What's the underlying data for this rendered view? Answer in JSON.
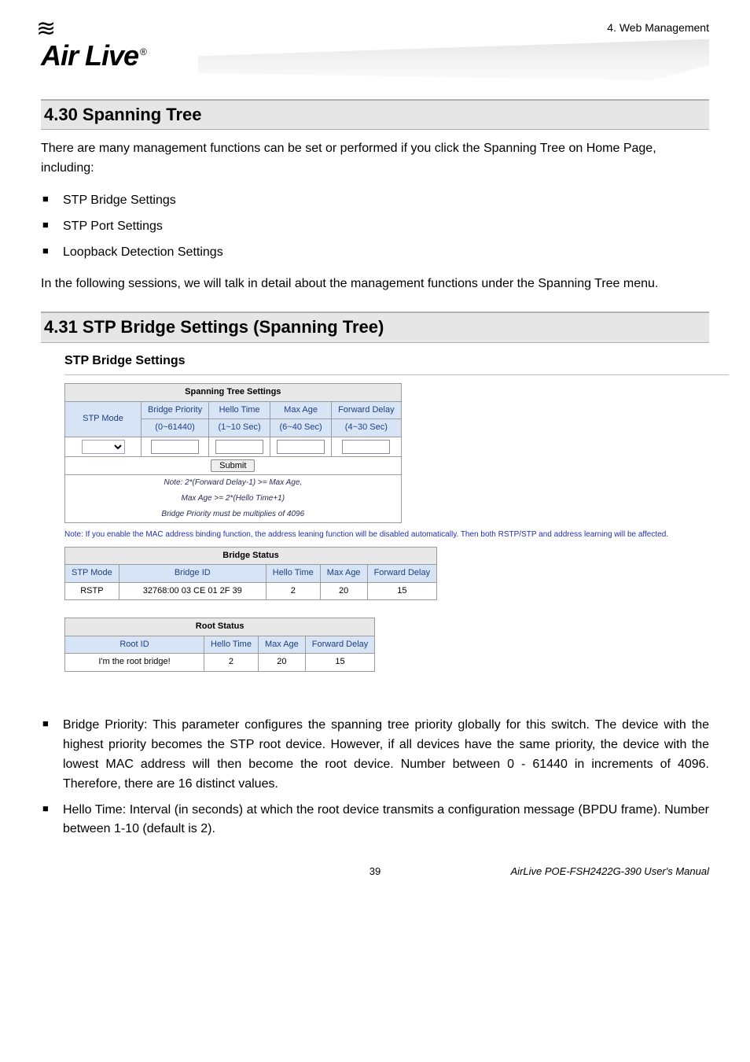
{
  "header": {
    "chapter": "4. Web Management"
  },
  "logo": {
    "brand": "Air Live",
    "swirl": "≋"
  },
  "section1": {
    "title": "4.30 Spanning Tree",
    "intro": "There are many management functions can be set or performed if you click the Spanning Tree on Home Page, including:",
    "bullets": [
      "STP Bridge Settings",
      "STP Port Settings",
      "Loopback Detection Settings"
    ],
    "outro": "In the following sessions, we will talk in detail about the management functions under the Spanning Tree menu."
  },
  "section2": {
    "title": "4.31 STP Bridge Settings (Spanning Tree)",
    "panel_heading": "STP Bridge Settings"
  },
  "spanning_settings": {
    "caption": "Spanning Tree Settings",
    "row_label": "STP Mode",
    "cols": [
      "Bridge Priority",
      "Hello Time",
      "Max Age",
      "Forward Delay"
    ],
    "ranges": [
      "(0~61440)",
      "(1~10 Sec)",
      "(6~40 Sec)",
      "(4~30 Sec)"
    ],
    "submit": "Submit",
    "notes": [
      "Note: 2*(Forward Delay-1) >= Max Age,",
      "Max Age >= 2*(Hello Time+1)",
      "Bridge Priority must be multiplies of 4096"
    ]
  },
  "warning": "Note: If you enable the MAC address binding function, the address leaning function will be disabled automatically. Then both RSTP/STP and address learning will be affected.",
  "bridge_status": {
    "caption": "Bridge Status",
    "cols": [
      "STP Mode",
      "Bridge ID",
      "Hello Time",
      "Max Age",
      "Forward Delay"
    ],
    "row": [
      "RSTP",
      "32768:00 03 CE 01 2F 39",
      "2",
      "20",
      "15"
    ]
  },
  "root_status": {
    "caption": "Root Status",
    "cols": [
      "Root ID",
      "Hello Time",
      "Max Age",
      "Forward Delay"
    ],
    "row": [
      "I'm the root bridge!",
      "2",
      "20",
      "15"
    ]
  },
  "descriptions": {
    "bridge_priority": "Bridge Priority: This parameter configures the spanning tree priority globally for this switch. The device with the highest priority becomes the STP root device. However, if all devices have the same priority, the device with the lowest MAC address will then become the root device. Number between 0 - 61440 in increments of 4096. Therefore, there are 16 distinct values.",
    "hello_time": "Hello Time: Interval (in seconds) at which the root device transmits a configuration message (BPDU frame). Number between 1-10 (default is 2)."
  },
  "footer": {
    "page": "39",
    "product": "AirLive POE-FSH2422G-390 User's Manual"
  }
}
